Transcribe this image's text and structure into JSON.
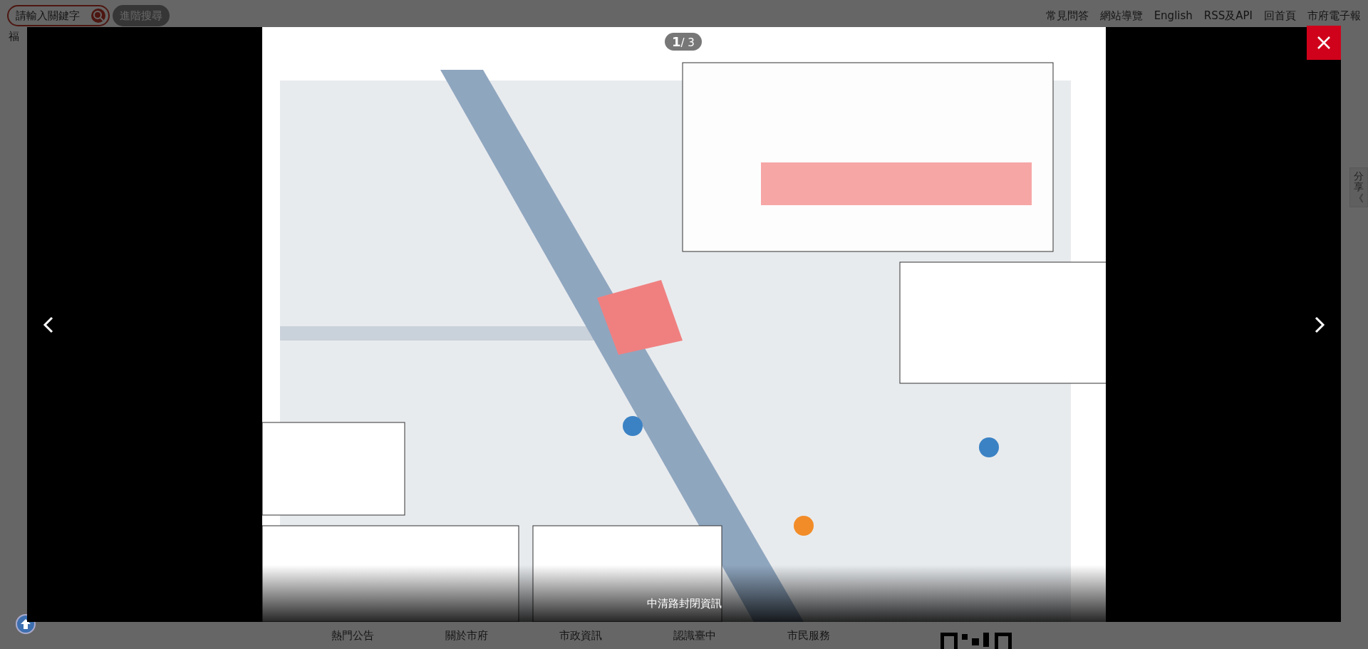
{
  "header": {
    "search": {
      "placeholder": "請輸入關鍵字"
    },
    "advanced_search": "進階搜尋",
    "side_text": "福",
    "links": [
      "常見問答",
      "網站導覽",
      "English",
      "RSS及API",
      "回首頁",
      "市府電子報"
    ]
  },
  "share_tab": {
    "label": "分享",
    "arrow": "《"
  },
  "lightbox": {
    "counter": "**1**/ 3",
    "caption": "中清路封閉資訊"
  },
  "footer": {
    "nav": [
      "熱門公告",
      "關於市府",
      "市政資訊",
      "認識臺中",
      "市民服務"
    ]
  }
}
